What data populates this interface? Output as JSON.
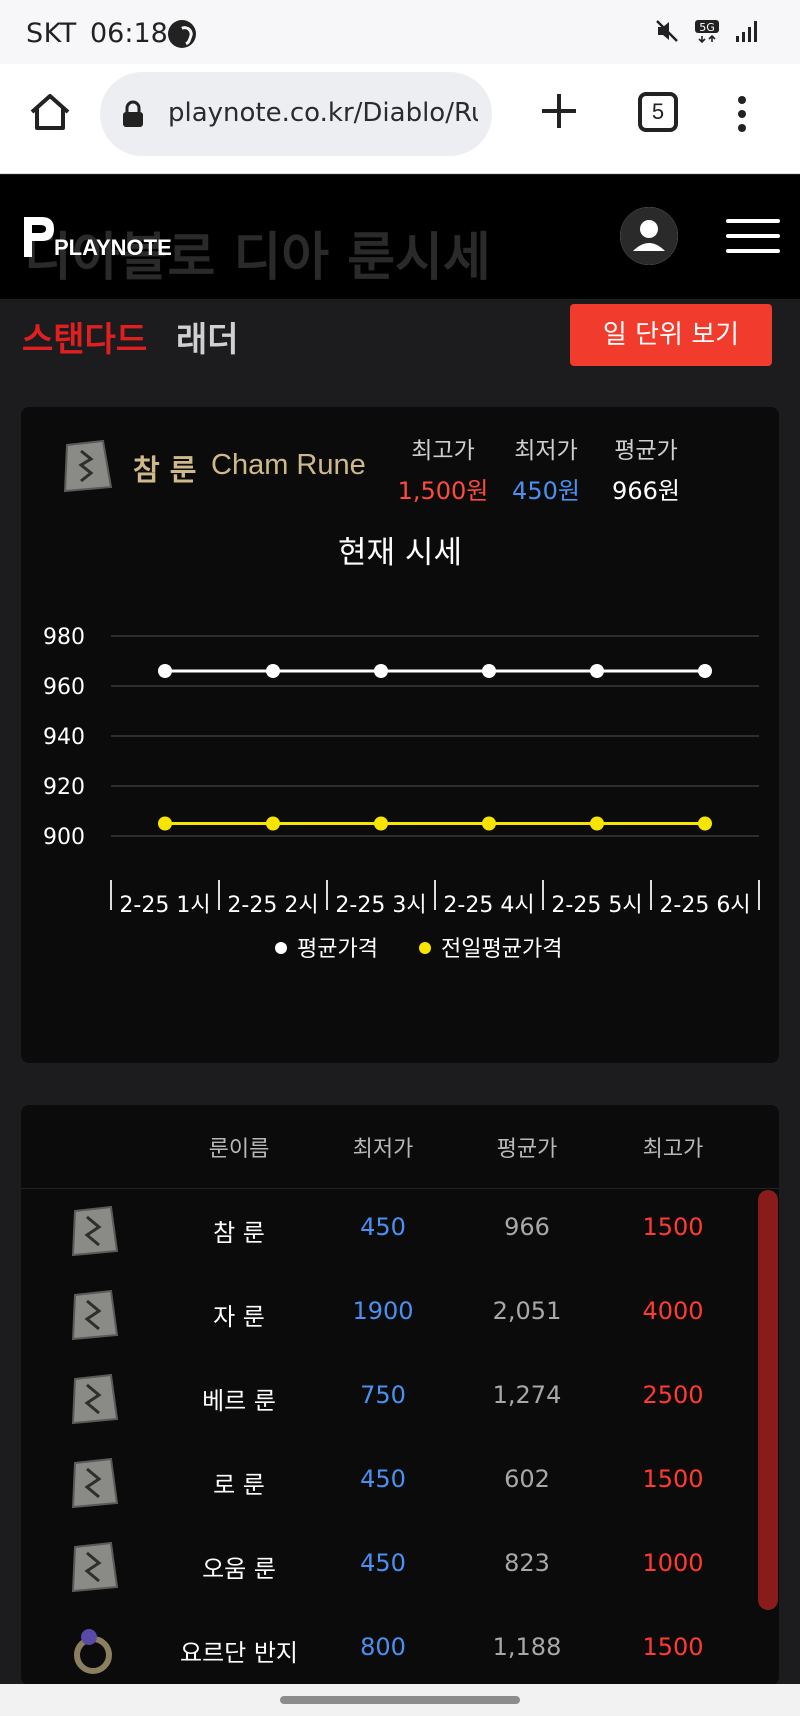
{
  "status_bar": {
    "carrier": "SKT",
    "time": "06:18",
    "network": "5G"
  },
  "browser": {
    "url": "playnote.co.kr/Diablo/Rur",
    "tab_count": "5"
  },
  "site": {
    "logo_text": "PLAYNOTE",
    "ghost_title": "디아블로 디아 룬시세"
  },
  "tabs": {
    "standard": "스탠다드",
    "ladder": "래더",
    "day_view": "일 단위 보기"
  },
  "rune_card": {
    "name_ko": "참 룬",
    "name_en": "Cham Rune",
    "stats": [
      {
        "label": "최고가",
        "value": "1,500원",
        "color": "#ff4a3d"
      },
      {
        "label": "최저가",
        "value": "450원",
        "color": "#4a90f0"
      },
      {
        "label": "평균가",
        "value": "966원",
        "color": "#ffffff"
      }
    ],
    "chart_title": "현재 시세"
  },
  "chart_data": {
    "type": "line",
    "title": "현재 시세",
    "x": [
      "2-25 1시",
      "2-25 2시",
      "2-25 3시",
      "2-25 4시",
      "2-25 5시",
      "2-25 6시"
    ],
    "series": [
      {
        "name": "평균가격",
        "color": "#ffffff",
        "values": [
          966,
          966,
          966,
          966,
          966,
          966
        ]
      },
      {
        "name": "전일평균가격",
        "color": "#f7e400",
        "values": [
          905,
          905,
          905,
          905,
          905,
          905
        ]
      }
    ],
    "yticks": [
      980,
      960,
      940,
      920,
      900
    ],
    "ylim": [
      900,
      980
    ],
    "grid": true,
    "legend": "bottom"
  },
  "table": {
    "headers": [
      "룬이름",
      "최저가",
      "평균가",
      "최고가"
    ],
    "rows": [
      {
        "name": "참 룬",
        "min": "450",
        "avg": "966",
        "max": "1500",
        "icon": "cham-rune-icon"
      },
      {
        "name": "자 룬",
        "min": "1900",
        "avg": "2,051",
        "max": "4000",
        "icon": "zod-rune-icon"
      },
      {
        "name": "베르 룬",
        "min": "750",
        "avg": "1,274",
        "max": "2500",
        "icon": "ber-rune-icon"
      },
      {
        "name": "로 룬",
        "min": "450",
        "avg": "602",
        "max": "1500",
        "icon": "lo-rune-icon"
      },
      {
        "name": "오움 룬",
        "min": "450",
        "avg": "823",
        "max": "1000",
        "icon": "ohm-rune-icon"
      },
      {
        "name": "요르단 반지",
        "min": "800",
        "avg": "1,188",
        "max": "1500",
        "icon": "jordan-ring-icon"
      }
    ]
  },
  "colors": {
    "min": "#4a90f0",
    "avg": "#a8a8a8",
    "max": "#ff3a30",
    "accent": "#f13b2d"
  }
}
